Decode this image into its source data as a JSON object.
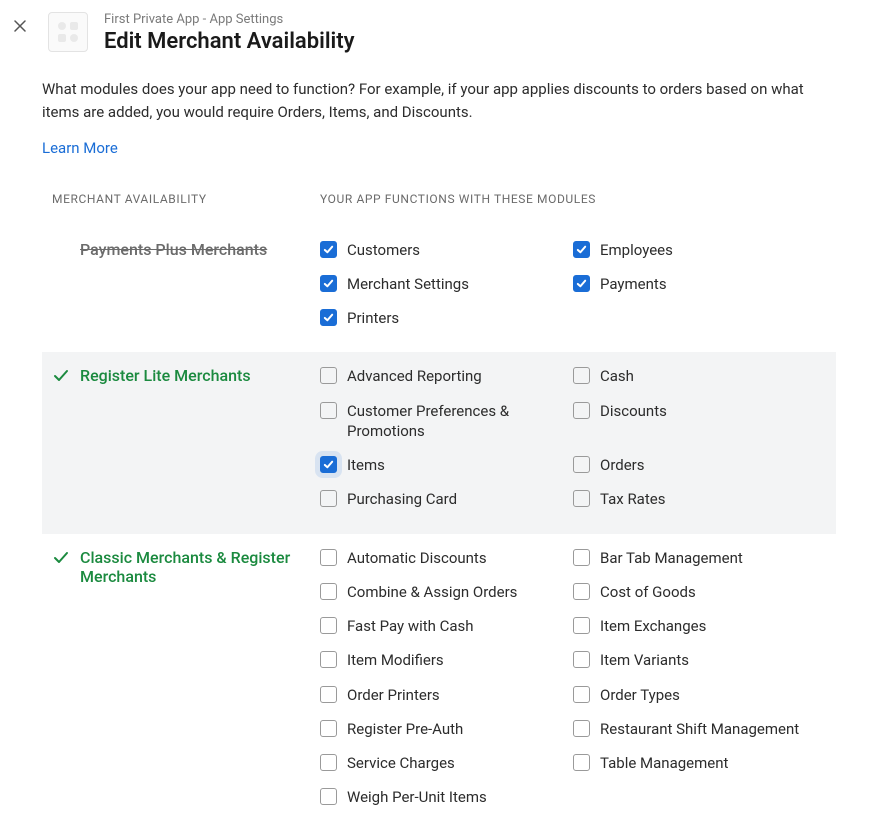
{
  "header": {
    "breadcrumb": "First Private App - App Settings",
    "title": "Edit Merchant Availability"
  },
  "intro": {
    "text": "What modules does your app need to function? For example, if your app applies discounts to orders based on what items are added, you would require Orders, Items, and Discounts.",
    "learn_more": "Learn More"
  },
  "columns": {
    "merchant": "MERCHANT AVAILABILITY",
    "modules": "YOUR APP FUNCTIONS WITH THESE MODULES"
  },
  "tiers": [
    {
      "id": "payments-plus",
      "name": "Payments Plus Merchants",
      "available": false,
      "highlight": false,
      "modules": [
        {
          "label": "Customers",
          "checked": true
        },
        {
          "label": "Employees",
          "checked": true
        },
        {
          "label": "Merchant Settings",
          "checked": true
        },
        {
          "label": "Payments",
          "checked": true
        },
        {
          "label": "Printers",
          "checked": true
        }
      ]
    },
    {
      "id": "register-lite",
      "name": "Register Lite Merchants",
      "available": true,
      "highlight": true,
      "modules": [
        {
          "label": "Advanced Reporting",
          "checked": false
        },
        {
          "label": "Cash",
          "checked": false
        },
        {
          "label": "Customer Preferences & Promotions",
          "checked": false
        },
        {
          "label": "Discounts",
          "checked": false
        },
        {
          "label": "Items",
          "checked": true,
          "halo": true
        },
        {
          "label": "Orders",
          "checked": false
        },
        {
          "label": "Purchasing Card",
          "checked": false
        },
        {
          "label": "Tax Rates",
          "checked": false
        }
      ]
    },
    {
      "id": "classic-register",
      "name": "Classic Merchants & Register Merchants",
      "available": true,
      "highlight": false,
      "modules": [
        {
          "label": "Automatic Discounts",
          "checked": false
        },
        {
          "label": "Bar Tab Management",
          "checked": false
        },
        {
          "label": "Combine & Assign Orders",
          "checked": false
        },
        {
          "label": "Cost of Goods",
          "checked": false
        },
        {
          "label": "Fast Pay with Cash",
          "checked": false
        },
        {
          "label": "Item Exchanges",
          "checked": false
        },
        {
          "label": "Item Modifiers",
          "checked": false
        },
        {
          "label": "Item Variants",
          "checked": false
        },
        {
          "label": "Order Printers",
          "checked": false
        },
        {
          "label": "Order Types",
          "checked": false
        },
        {
          "label": "Register Pre-Auth",
          "checked": false
        },
        {
          "label": "Restaurant Shift Management",
          "checked": false
        },
        {
          "label": "Service Charges",
          "checked": false
        },
        {
          "label": "Table Management",
          "checked": false
        },
        {
          "label": "Weigh Per-Unit Items",
          "checked": false
        }
      ]
    }
  ]
}
